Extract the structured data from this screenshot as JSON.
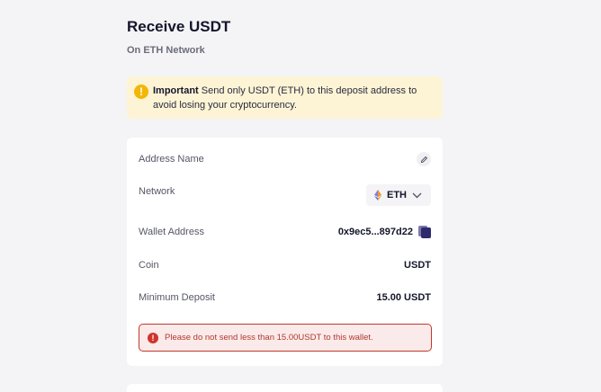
{
  "header": {
    "title": "Receive USDT",
    "subtitle": "On ETH Network"
  },
  "notice": {
    "icon": "exclamation-icon",
    "bold": "Important",
    "text": " Send only USDT (ETH) to this deposit address to avoid losing your cryptocurrency."
  },
  "details": {
    "address_name_label": "Address Name",
    "network_label": "Network",
    "network_value": "ETH",
    "wallet_label": "Wallet Address",
    "wallet_value": "0x9ec5...897d22",
    "coin_label": "Coin",
    "coin_value": "USDT",
    "min_deposit_label": "Minimum Deposit",
    "min_deposit_value": "15.00 USDT"
  },
  "warning": {
    "text": "Please do not send less than 15.00USDT to this wallet."
  },
  "colors": {
    "notice_bg": "#fdf4d6",
    "notice_icon": "#f2b705",
    "warning_border": "#c0392b",
    "warning_bg": "#fbeaea"
  }
}
